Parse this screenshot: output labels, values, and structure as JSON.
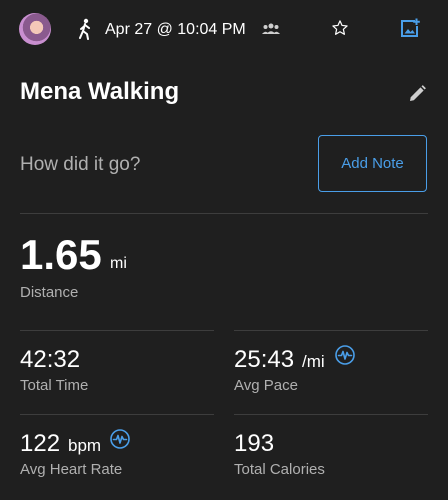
{
  "header": {
    "date_time": "Apr 27 @ 10:04 PM",
    "activity_icon": "walking-person-icon",
    "group_icon": "group-icon",
    "favorite_icon": "star-outline-icon",
    "photo_icon": "add-photo-icon"
  },
  "activity": {
    "title": "Mena Walking",
    "edit_icon": "pencil-icon"
  },
  "note": {
    "prompt": "How did it go?",
    "button_label": "Add Note"
  },
  "distance": {
    "value": "1.65",
    "unit": "mi",
    "label": "Distance"
  },
  "stats": {
    "total_time": {
      "value": "42:32",
      "label": "Total Time"
    },
    "avg_pace": {
      "value": "25:43",
      "unit": "/mi",
      "label": "Avg Pace"
    },
    "avg_heart_rate": {
      "value": "122",
      "unit": "bpm",
      "label": "Avg Heart Rate"
    },
    "total_calories": {
      "value": "193",
      "label": "Total Calories"
    }
  },
  "colors": {
    "background": "#1f1f1f",
    "accent": "#4a9ee8",
    "secondary_text": "#b0b0b0",
    "divider": "#3d3d3d"
  }
}
